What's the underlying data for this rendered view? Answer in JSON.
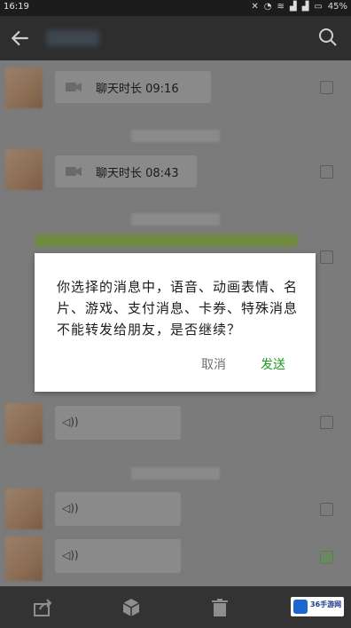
{
  "status_bar": {
    "time": "16:19",
    "battery": "45%"
  },
  "header": {
    "back_icon": "arrow-left-icon",
    "search_icon": "search-icon"
  },
  "messages": [
    {
      "type": "video_call",
      "text": "聊天时长 09:16",
      "selected": false
    },
    {
      "type": "video_call",
      "text": "聊天时长 08:43",
      "selected": false
    },
    {
      "type": "voice",
      "selected": false
    },
    {
      "type": "voice",
      "selected": false
    },
    {
      "type": "voice",
      "selected": true
    }
  ],
  "dialog": {
    "message": "你选择的消息中，语音、动画表情、名片、游戏、支付消息、卡券、特殊消息不能转发给朋友，是否继续？",
    "cancel_label": "取消",
    "send_label": "发送",
    "send_color": "#1d9b1d"
  },
  "bottom_bar": {
    "icons": [
      "share-icon",
      "cube-favorite-icon",
      "trash-icon"
    ]
  },
  "watermark": {
    "text": "36手游网"
  }
}
